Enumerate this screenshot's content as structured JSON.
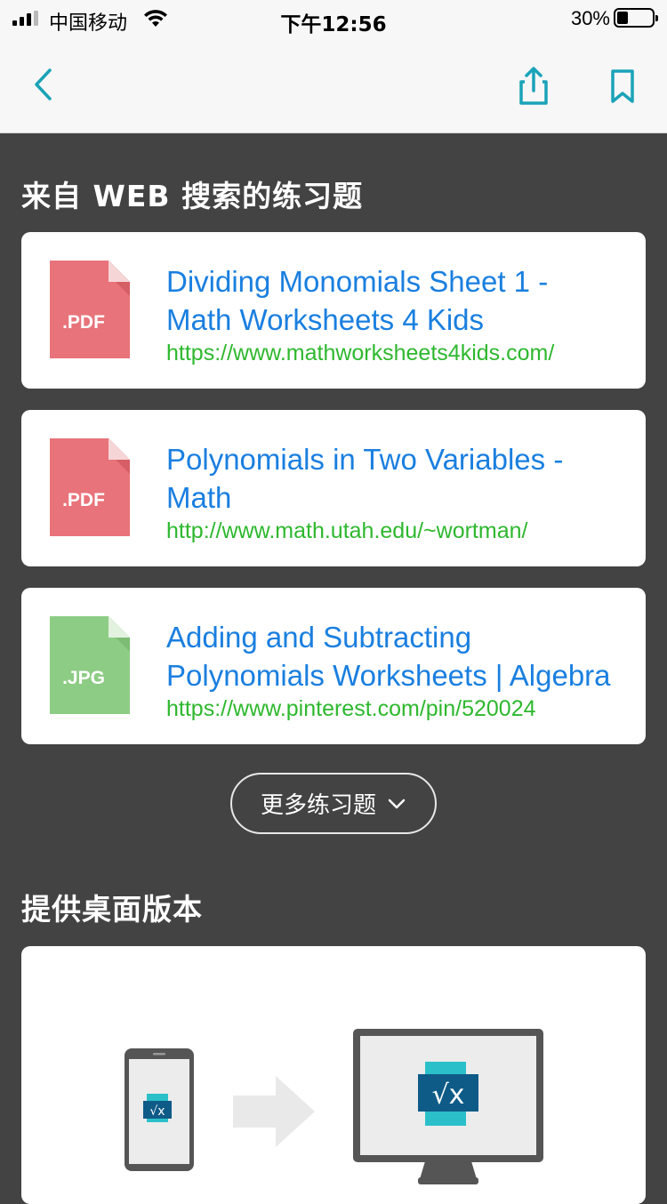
{
  "status": {
    "carrier": "中国移动",
    "time": "下午12:56",
    "battery": "30%",
    "battery_level": 0.3
  },
  "nav": {
    "icons": [
      "back-chevron-icon",
      "share-icon",
      "bookmark-icon"
    ],
    "accent_color": "#1aa3b8"
  },
  "sections": {
    "practice_title": "来自 WEB 搜索的练习题",
    "desktop_title": "提供桌面版本"
  },
  "results": [
    {
      "type": ".PDF",
      "title": "Dividing Monomials Sheet 1 - Math Worksheets 4 Kids",
      "url": "https://www.mathworksheets4kids.com/",
      "icon_color": "#e8737a"
    },
    {
      "type": ".PDF",
      "title": "Polynomials in Two Variables - Math",
      "url": "http://www.math.utah.edu/~wortman/",
      "icon_color": "#e8737a"
    },
    {
      "type": ".JPG",
      "title": "Adding and Subtracting Polynomials Worksheets | Algebra",
      "url": "https://www.pinterest.com/pin/520024",
      "icon_color": "#8dcc84"
    }
  ],
  "more_button": {
    "label": "更多练习题",
    "icon": "chevron-down-icon"
  },
  "desktop_illustration": {
    "app_icon_label": "√x",
    "icons": [
      "phone-icon",
      "arrow-right-icon",
      "monitor-icon"
    ]
  }
}
